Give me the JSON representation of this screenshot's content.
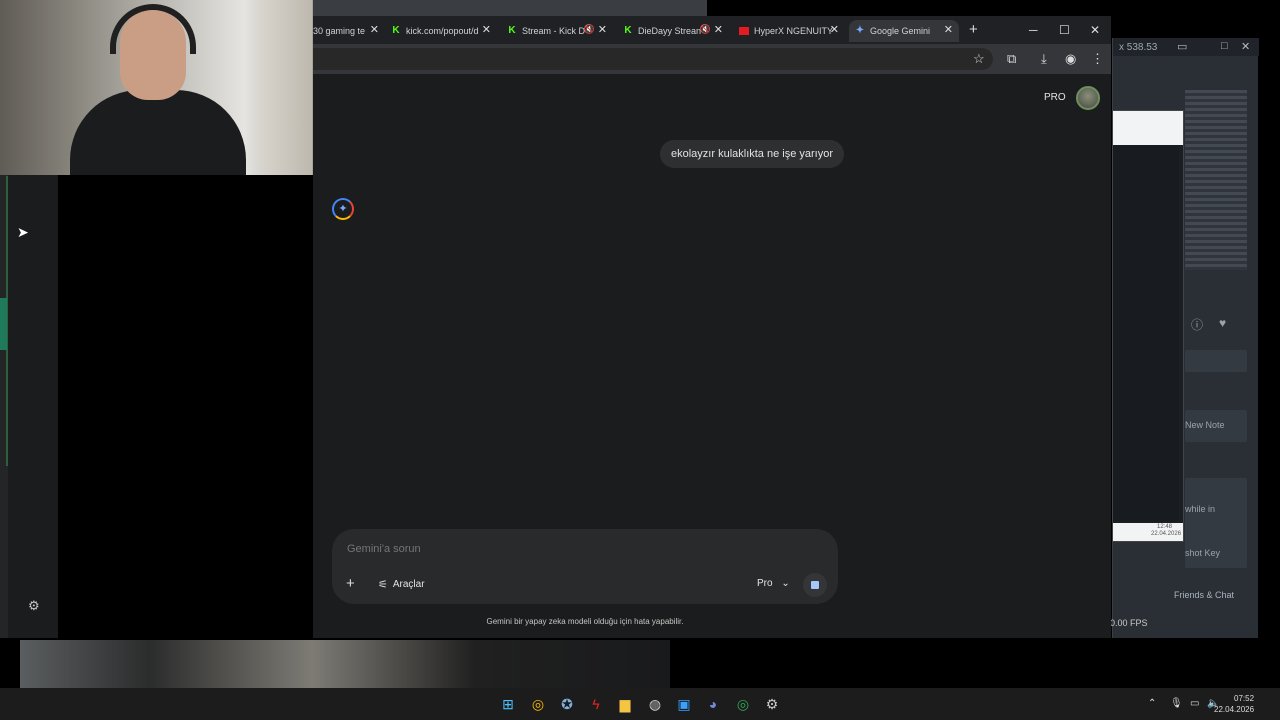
{
  "webcam": {
    "label": ""
  },
  "chrome": {
    "tabs": [
      {
        "label": "30 gaming te",
        "icon": "page-icon"
      },
      {
        "label": "kick.com/popout/d",
        "icon": "kick-icon"
      },
      {
        "label": "Stream - Kick D",
        "icon": "kick-icon",
        "muted": true
      },
      {
        "label": "DieDayy Strean",
        "icon": "kick-icon",
        "muted": true
      },
      {
        "label": "HyperX NGENUITY",
        "icon": "hyperx-icon"
      },
      {
        "label": "Google Gemini",
        "icon": "gemini-icon",
        "active": true
      }
    ]
  },
  "gemini": {
    "plan_badge": "PRO",
    "user_message": "ekolayzır kulaklıkta ne işe yarıyor",
    "composer": {
      "placeholder": "Gemini'a sorun",
      "tools_label": "Araçlar",
      "model_label": "Pro"
    },
    "disclaimer": "Gemini bir yapay zeka modeli olduğu için hata yapabilir."
  },
  "background": {
    "new_note": "New Note",
    "while_in": "while in",
    "shot_key": "shot Key",
    "friends_chat": "Friends & Chat",
    "fps": "0.00 FPS",
    "size_readout": "x 538.53",
    "small_clock_time": "12:48",
    "small_clock_date": "22.04.2026"
  },
  "taskbar": {
    "time": "07:52",
    "date": "22.04.2026"
  }
}
